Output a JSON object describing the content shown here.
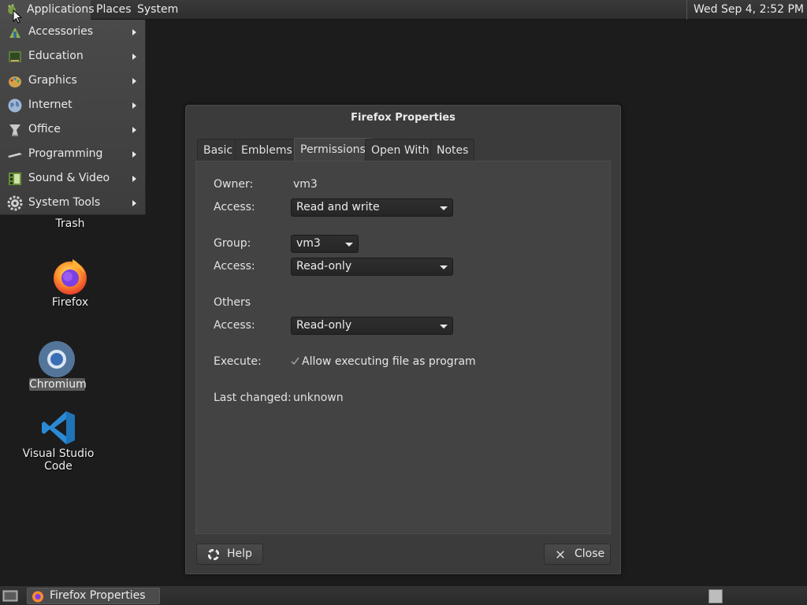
{
  "top_panel": {
    "applications": "Applications",
    "places": "Places",
    "system": "System",
    "clock": "Wed Sep  4,  2:52 PM"
  },
  "apps_menu": {
    "items": [
      {
        "label": "Accessories",
        "icon": "accessories-icon"
      },
      {
        "label": "Education",
        "icon": "education-icon"
      },
      {
        "label": "Graphics",
        "icon": "graphics-icon"
      },
      {
        "label": "Internet",
        "icon": "internet-icon"
      },
      {
        "label": "Office",
        "icon": "office-icon"
      },
      {
        "label": "Programming",
        "icon": "programming-icon"
      },
      {
        "label": "Sound & Video",
        "icon": "sound-video-icon"
      },
      {
        "label": "System Tools",
        "icon": "system-tools-icon"
      }
    ]
  },
  "desktop": {
    "trash_label": "Trash",
    "firefox_label": "Firefox",
    "chromium_label": "Chromium",
    "vscode_label": "Visual Studio Code"
  },
  "dialog": {
    "title": "Firefox Properties",
    "tabs": [
      "Basic",
      "Emblems",
      "Permissions",
      "Open With",
      "Notes"
    ],
    "active_tab": "Permissions",
    "owner_label": "Owner:",
    "owner_value": "vm3",
    "owner_access_label": "Access:",
    "owner_access_value": "Read and write",
    "group_label": "Group:",
    "group_value": "vm3",
    "group_access_label": "Access:",
    "group_access_value": "Read-only",
    "others_label": "Others",
    "others_access_label": "Access:",
    "others_access_value": "Read-only",
    "execute_label": "Execute:",
    "execute_checkbox_label": "Allow executing file as program",
    "execute_checked": true,
    "last_changed_label": "Last changed:",
    "last_changed_value": "unknown",
    "help_button": "Help",
    "close_button": "Close"
  },
  "bottom_panel": {
    "task_label": "Firefox Properties"
  },
  "colors": {
    "desktop_bg": "#1c1c1c",
    "panel_bg": "#2e2e2e",
    "dialog_bg": "#3b3b3b",
    "firefox_orange": "#ff7139",
    "vscode_blue": "#2a8ad6",
    "chromium_blue": "#4f8cc9"
  }
}
